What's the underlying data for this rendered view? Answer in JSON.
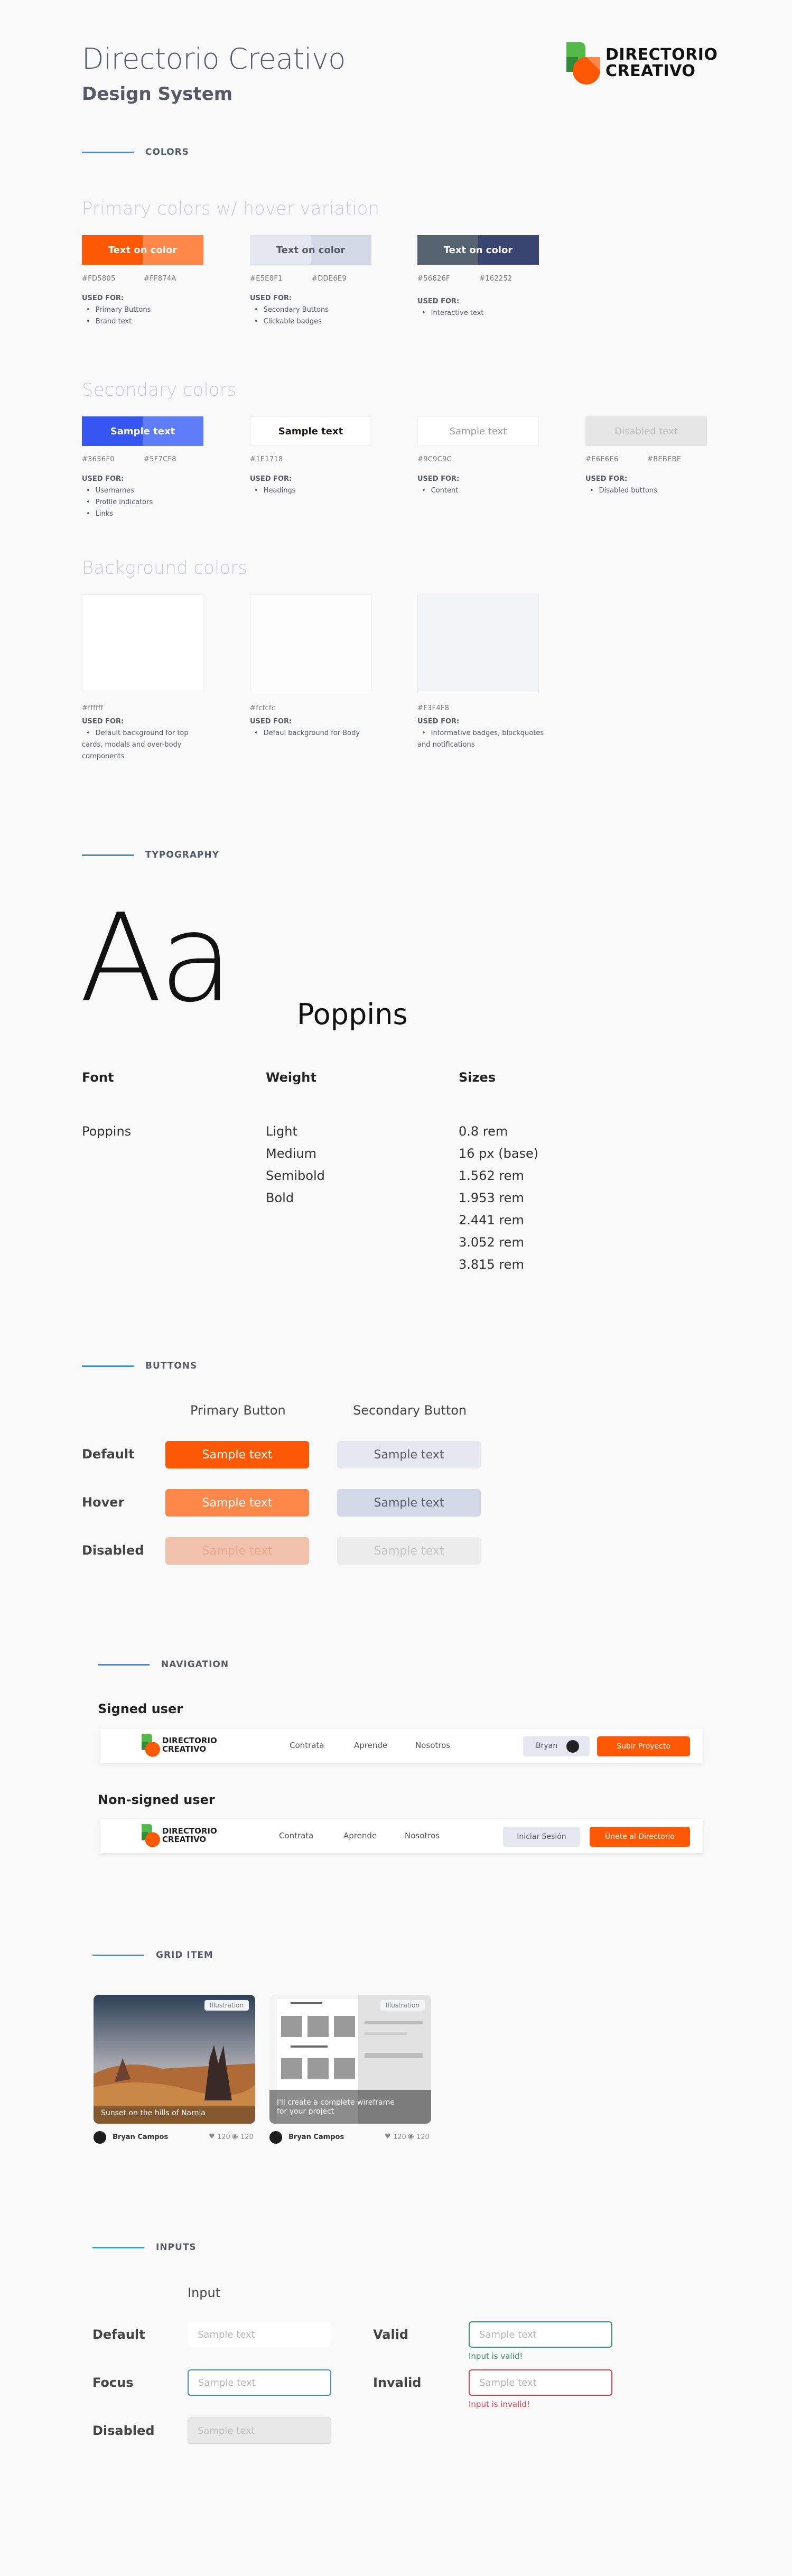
{
  "header": {
    "title": "Directorio Creativo",
    "subtitle": "Design System",
    "logo_line1": "DIRECTORIO",
    "logo_line2": "CREATIVO"
  },
  "colors": {
    "section_label": "COLORS",
    "primary_title": "Primary colors w/ hover variation",
    "secondary_title": "Secondary colors",
    "background_title": "Background colors",
    "used_for_label": "USED FOR:",
    "primary": [
      {
        "label": "Text on color",
        "hex1": "#FD5805",
        "hex2": "#FF874A",
        "uses": [
          "Primary Buttons",
          "Brand text"
        ]
      },
      {
        "label": "Text on color",
        "hex1": "#E5E8F1",
        "hex2": "#DDE6E9",
        "uses": [
          "Secondary Buttons",
          "Clickable badges"
        ]
      },
      {
        "label": "Text on color",
        "hex1": "#56626F",
        "hex2": "#162252",
        "uses": [
          "Interactive text"
        ]
      }
    ],
    "secondary": [
      {
        "label": "Sample text",
        "hex1": "#3656F0",
        "hex2": "#5F7CF8",
        "uses": [
          "Usernames",
          "Profile indicators",
          "Links"
        ]
      },
      {
        "label": "Sample text",
        "hex1": "#1E1718",
        "hex2": "",
        "uses": [
          "Headings"
        ]
      },
      {
        "label": "Sample text",
        "hex1": "#9C9C9C",
        "hex2": "",
        "uses": [
          "Content"
        ]
      },
      {
        "label": "Disabled text",
        "hex1": "#E6E6E6",
        "hex2": "#BEBEBE",
        "uses": [
          "Disabled buttons"
        ]
      }
    ],
    "backgrounds": [
      {
        "hex": "#ffffff",
        "uses": [
          "Default background for top cards, modals and over-body components"
        ]
      },
      {
        "hex": "#fcfcfc",
        "uses": [
          "Defaul background for Body"
        ]
      },
      {
        "hex": "#F3F4F8",
        "uses": [
          "Informative badges, blockquotes and notifications"
        ]
      }
    ],
    "palette": {
      "orange": "#fd5805",
      "orange_hover": "#ff874a",
      "light": "#e5e8f1",
      "light_hover": "#d4d9e8",
      "slate": "#56626f",
      "navy": "#3a4470",
      "blue": "#3656f0",
      "blue_hover": "#5f7cf8"
    }
  },
  "typography": {
    "section_label": "TYPOGRAPHY",
    "sample": "Aa",
    "font_name": "Poppins",
    "headers": {
      "font": "Font",
      "weight": "Weight",
      "sizes": "Sizes"
    },
    "font_value": "Poppins",
    "weights": [
      "Light",
      "Medium",
      "Semibold",
      "Bold"
    ],
    "sizes": [
      "0.8 rem",
      "16 px (base)",
      "1.562 rem",
      "1.953 rem",
      "2.441 rem",
      "3.052 rem",
      "3.815 rem"
    ]
  },
  "buttons": {
    "section_label": "BUTTONS",
    "primary_header": "Primary Button",
    "secondary_header": "Secondary Button",
    "rows": [
      "Default",
      "Hover",
      "Disabled"
    ],
    "label": "Sample text"
  },
  "navigation": {
    "section_label": "NAVIGATION",
    "signed_title": "Signed user",
    "nonsigned_title": "Non-signed user",
    "logo_line1": "DIRECTORIO",
    "logo_line2": "CREATIVO",
    "links": [
      "Contrata",
      "Aprende",
      "Nosotros"
    ],
    "user_name": "Bryan",
    "upload_button": "Subir Proyecto",
    "login_button": "Iniciar Sesión",
    "join_button": "Únete al Directorio"
  },
  "grid_item": {
    "section_label": "GRID ITEM",
    "cards": [
      {
        "badge": "Illustration",
        "caption": "Sunset on the hills of Narnia",
        "author": "Bryan Campos",
        "likes": "120",
        "views": "120"
      },
      {
        "badge": "Illustration",
        "caption": "I'll create a complete wireframe for your project",
        "author": "Bryan Campos",
        "likes": "120",
        "views": "120"
      }
    ]
  },
  "inputs": {
    "section_label": "INPUTS",
    "column_header": "Input",
    "labels": {
      "default": "Default",
      "focus": "Focus",
      "disabled": "Disabled",
      "valid": "Valid",
      "invalid": "Invalid"
    },
    "placeholder": "Sample text",
    "valid_message": "Input is valid!",
    "invalid_message": "Input is invalid!"
  }
}
